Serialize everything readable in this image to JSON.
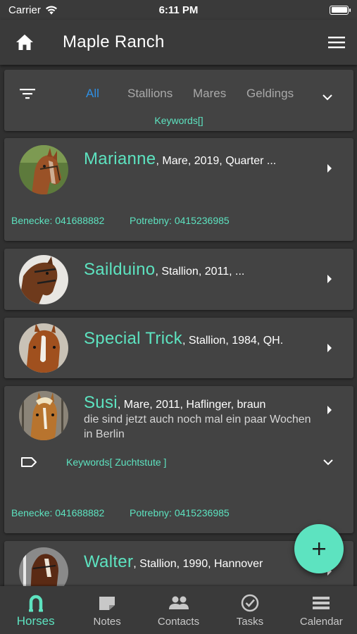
{
  "status_bar": {
    "carrier": "Carrier",
    "time": "6:11 PM",
    "battery_level": 1.0
  },
  "app_bar": {
    "title": "Maple Ranch",
    "home_icon": "home-icon",
    "menu_icon": "hamburger-menu-icon"
  },
  "filter": {
    "tabs": [
      "All",
      "Stallions",
      "Mares",
      "Geldings"
    ],
    "active_tab": "All",
    "keywords": "Keywords[]"
  },
  "horses": [
    {
      "name": "Marianne",
      "details": ", Mare, 2019, Quarter ...",
      "description": "",
      "contacts": [
        "Benecke: 041688882",
        "Potrebny: 0415236985"
      ],
      "keywords": ""
    },
    {
      "name": "Sailduino",
      "details": ", Stallion, 2011, ...",
      "description": "",
      "contacts": [],
      "keywords": ""
    },
    {
      "name": "Special Trick",
      "details": ", Stallion, 1984, QH.",
      "description": "",
      "contacts": [],
      "keywords": ""
    },
    {
      "name": "Susi",
      "details": ", Mare, 2011, Haflinger, braun",
      "description": "die sind jetzt auch noch mal ein paar Wochen in Berlin",
      "contacts": [
        "Benecke: 041688882",
        "Potrebny: 0415236985"
      ],
      "keywords": "Keywords[ Zuchtstute ]"
    },
    {
      "name": "Walter",
      "details": ", Stallion, 1990, Hannover",
      "description": "",
      "contacts": [],
      "keywords": ""
    }
  ],
  "fab": {
    "icon": "plus-icon"
  },
  "bottom_nav": [
    {
      "label": "Horses",
      "icon": "horseshoe-icon",
      "active": true
    },
    {
      "label": "Notes",
      "icon": "note-icon",
      "active": false
    },
    {
      "label": "Contacts",
      "icon": "people-icon",
      "active": false
    },
    {
      "label": "Tasks",
      "icon": "check-circle-icon",
      "active": false
    },
    {
      "label": "Calendar",
      "icon": "calendar-icon",
      "active": false
    }
  ],
  "colors": {
    "accent": "#5de3c0",
    "active_tab": "#2f8fe3",
    "card": "#434343",
    "background": "#303030"
  }
}
